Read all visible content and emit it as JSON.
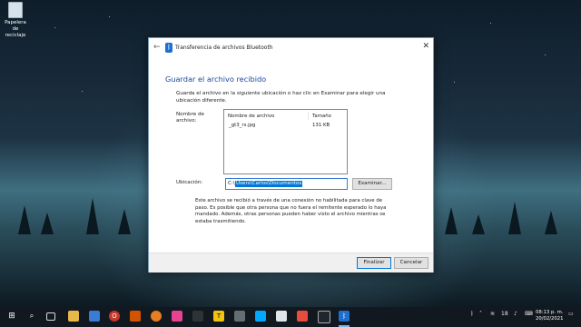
{
  "desktop": {
    "recycle_bin_label": "Papelera de reciclaje"
  },
  "dialog": {
    "title": "Transferencia de archivos Bluetooth",
    "heading": "Guardar el archivo recibido",
    "intro": "Guarda el archivo en la siguiente ubicación o haz clic en Examinar para elegir una ubicación diferente.",
    "file_name_label": "Nombre de archivo:",
    "columns": [
      "Nombre de archivo",
      "Tamaño"
    ],
    "files": [
      {
        "name": "_gt3_rs.jpg",
        "size": "131 KB"
      }
    ],
    "location_label": "Ubicación:",
    "location_prefix": "C:\\",
    "location_selected": "Users\\Carlos\\Documentos",
    "browse_label": "Examinar...",
    "note": "Este archivo se recibió a través de una conexión no habilitada para clave de paso. Es posible que otra persona que no fuera el remitente esperado lo haya mandado. Además, otras personas pueden haber visto el archivo mientras se estaba trasmitiendo.",
    "finish_label": "Finalizar",
    "cancel_label": "Cancelar"
  },
  "taskbar": {
    "clock_time": "08:13 p. m.",
    "clock_date": "20/02/2021",
    "tray_badge": "18",
    "notification_count": "2",
    "apps": [
      "start",
      "search",
      "task-view",
      "file-explorer",
      "store",
      "mail",
      "opera",
      "photos",
      "app-red",
      "app-media",
      "app-pink",
      "app-game",
      "app-photo",
      "app-fire",
      "app-yellow",
      "controller",
      "app-mixer",
      "app-messenger",
      "app-dark",
      "app-eye",
      "bluetooth-transfer"
    ]
  }
}
